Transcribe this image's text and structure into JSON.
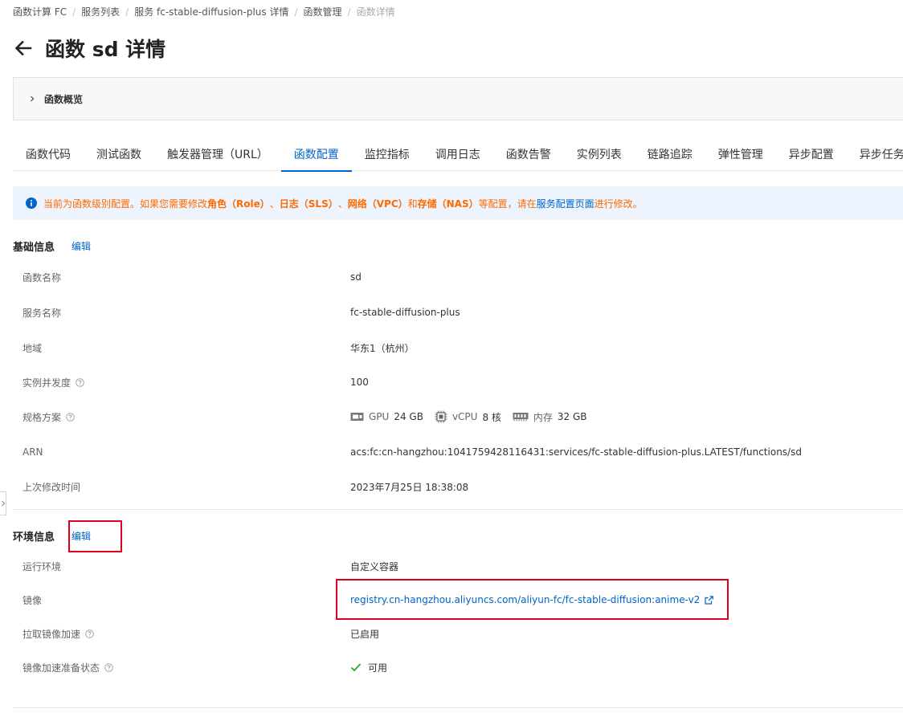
{
  "breadcrumb": [
    "函数计算 FC",
    "服务列表",
    "服务 fc-stable-diffusion-plus 详情",
    "函数管理",
    "函数详情"
  ],
  "page_title": "函数 sd 详情",
  "overview": {
    "label": "函数概览"
  },
  "tabs": [
    "函数代码",
    "测试函数",
    "触发器管理（URL）",
    "函数配置",
    "监控指标",
    "调用日志",
    "函数告警",
    "实例列表",
    "链路追踪",
    "弹性管理",
    "异步配置",
    "异步任务"
  ],
  "active_tab": "函数配置",
  "notice": {
    "p1": "当前为函数级别配置。如果您需要修改",
    "role": "角色（Role）",
    "sep1": "、",
    "log": "日志（SLS）",
    "sep2": "、",
    "net": "网络（VPC）",
    "and": "和",
    "nas": "存储（NAS）",
    "p2": "等配置，请在",
    "link": "服务配置页面",
    "p3": "进行修改。"
  },
  "basic": {
    "title": "基础信息",
    "edit": "编辑",
    "function_name_label": "函数名称",
    "function_name": "sd",
    "service_name_label": "服务名称",
    "service_name": "fc-stable-diffusion-plus",
    "region_label": "地域",
    "region": "华东1（杭州）",
    "concurrency_label": "实例并发度",
    "concurrency": "100",
    "spec_label": "规格方案",
    "gpu_label": "GPU",
    "gpu": "24 GB",
    "vcpu_label": "vCPU",
    "vcpu": "8 核",
    "mem_label": "内存",
    "mem": "32 GB",
    "arn_label": "ARN",
    "arn": "acs:fc:cn-hangzhou:1041759428116431:services/fc-stable-diffusion-plus.LATEST/functions/sd",
    "modified_label": "上次修改时间",
    "modified": "2023年7月25日 18:38:08"
  },
  "env": {
    "title": "环境信息",
    "edit": "编辑",
    "runtime_label": "运行环境",
    "runtime": "自定义容器",
    "image_label": "镜像",
    "image": "registry.cn-hangzhou.aliyuncs.com/aliyun-fc/fc-stable-diffusion:anime-v2",
    "accel_label": "拉取镜像加速",
    "accel": "已启用",
    "accel_status_label": "镜像加速准备状态",
    "accel_status": "可用"
  },
  "colors": {
    "link": "#0064c8",
    "warning_text": "#ff6a00",
    "notice_bg": "#edf4fd",
    "highlight_box": "#e0001b",
    "success": "#1fa830"
  }
}
